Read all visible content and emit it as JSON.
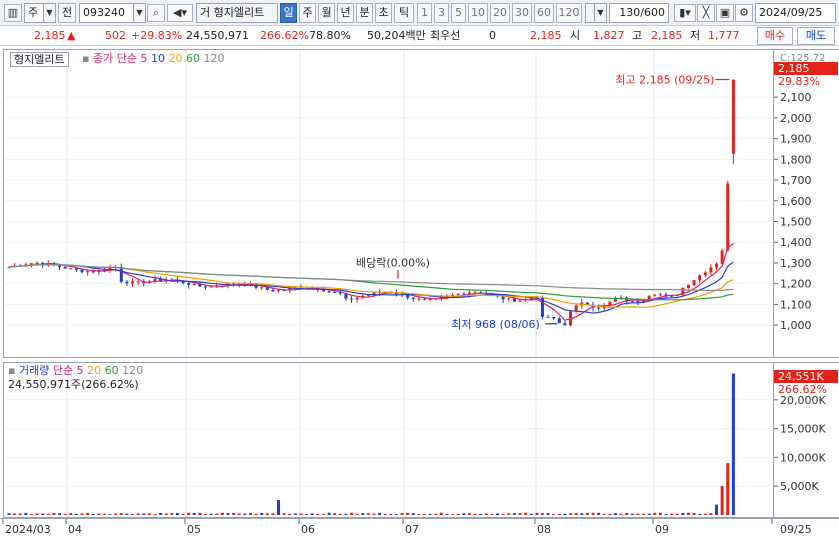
{
  "toolbar": {
    "market": "주",
    "prev_label": "전",
    "code": "093240",
    "name_prefix": "거",
    "name": "형지엘리트",
    "periods": [
      "일",
      "주",
      "월",
      "년",
      "분",
      "초",
      "틱"
    ],
    "selected_period": "일",
    "intervals": [
      "1",
      "3",
      "5",
      "10",
      "20",
      "30",
      "60",
      "120"
    ],
    "count": "130/600",
    "date": "2024/09/25"
  },
  "quote": {
    "price": "2,185",
    "change": "502",
    "change_pct": "+29.83%",
    "volume": "24,550,971",
    "volume_pct": "266.62%",
    "ratio": "78.80%",
    "amount": "50,204백만",
    "priority_label": "최우선",
    "priority_value": "0",
    "ask": "2,185",
    "open_label": "시",
    "open": "1,827",
    "high_label": "고",
    "high": "2,185",
    "low_label": "저",
    "low": "1,777",
    "buy_label": "매수",
    "sell_label": "매도"
  },
  "price_pane": {
    "stock_tag": "형지엘리트",
    "legend_title": "종가 단순",
    "ma_periods": [
      "5",
      "10",
      "20",
      "60",
      "120"
    ],
    "ma_colors": [
      "#d6246e",
      "#2a3bd6",
      "#f0a000",
      "#2e9c3a",
      "#8a8a8a"
    ],
    "high_annotation": "최고 2,185 (09/25)",
    "low_annotation": "최저 968 (08/06)",
    "dividend_annotation": "배당락(0.00%)",
    "axis_top_label": "C:125.72",
    "current_price_tag": "2,185",
    "current_pct_tag": "29.83%"
  },
  "volume_pane": {
    "legend_title": "거래량",
    "legend_sub": "단순",
    "ma_periods": [
      "5",
      "20",
      "60",
      "120"
    ],
    "value_text": "24,550,971주(266.62%)",
    "current_tag": "24,551K",
    "current_pct": "266.62%"
  },
  "chart_data": {
    "type": "candlestick",
    "price_axis": {
      "ylim": [
        880,
        2260
      ],
      "ticks": [
        "2,100",
        "2,000",
        "1,900",
        "1,800",
        "1,700",
        "1,600",
        "1,500",
        "1,400",
        "1,300",
        "1,200",
        "1,100",
        "1,000"
      ]
    },
    "volume_axis": {
      "ylim": [
        0,
        25000
      ],
      "ticks": [
        "20,000K",
        "15,000K",
        "10,000K",
        "5,000K"
      ]
    },
    "date_labels": [
      "2024/03",
      "04",
      "05",
      "06",
      "07",
      "08",
      "09",
      "09/25"
    ],
    "ohlc_recent": [
      {
        "date": "09/25",
        "open": 1827,
        "high": 2185,
        "low": 1777,
        "close": 2185
      }
    ],
    "high": {
      "date": "09/25",
      "price": 2185
    },
    "low": {
      "date": "08/06",
      "price": 968
    }
  },
  "colors": {
    "up": "#e2231a",
    "down": "#1a3fd6",
    "accent": "#3a74c7"
  }
}
